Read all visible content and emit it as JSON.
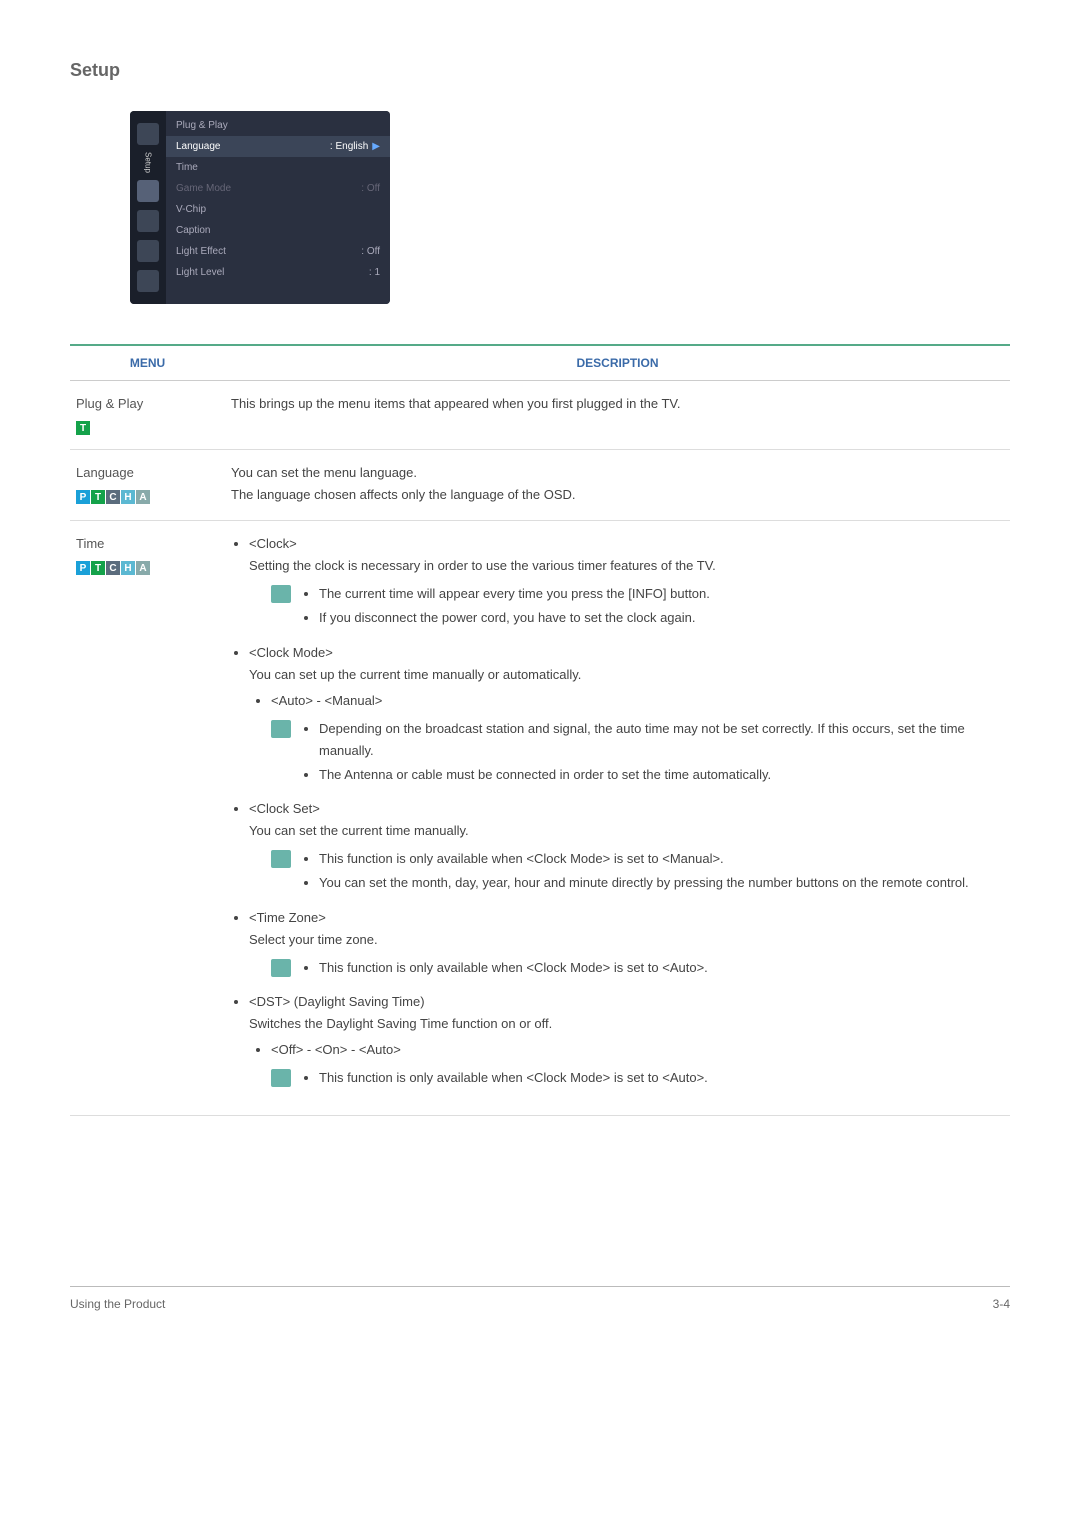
{
  "page_title": "Setup",
  "osd": {
    "sidetext": "Setup",
    "rows": [
      {
        "label": "Plug & Play",
        "value": ""
      },
      {
        "label": "Language",
        "value": "English",
        "selected": true,
        "arrow": true
      },
      {
        "label": "Time",
        "value": ""
      },
      {
        "label": "Game Mode",
        "value": "Off",
        "dim": true
      },
      {
        "label": "V-Chip",
        "value": ""
      },
      {
        "label": "Caption",
        "value": ""
      },
      {
        "label": "Light Effect",
        "value": "Off"
      },
      {
        "label": "Light Level",
        "value": "1"
      }
    ]
  },
  "table_headers": {
    "menu": "Menu",
    "desc": "Description"
  },
  "rows": {
    "plugplay": {
      "name": "Plug & Play",
      "badges": [
        "T"
      ],
      "desc": "This brings up the menu items that appeared when you first plugged in the TV."
    },
    "language": {
      "name": "Language",
      "badges": [
        "P",
        "T",
        "C",
        "H",
        "A"
      ],
      "desc1": "You can set the menu language.",
      "desc2": "The language chosen affects only the language of the OSD."
    },
    "time": {
      "name": "Time",
      "badges": [
        "P",
        "T",
        "C",
        "H",
        "A"
      ],
      "clock": {
        "title": "<Clock>",
        "sub": "Setting the clock is necessary in order to use the various timer features of the TV.",
        "note1": "The current time will appear every time you press the [INFO] button.",
        "note2": "If you disconnect the power cord, you have to set the clock again."
      },
      "clockmode": {
        "title": "<Clock Mode>",
        "sub": "You can set up the current time manually or automatically.",
        "opt": "<Auto> - <Manual>",
        "note1": "Depending on the broadcast station and signal, the auto time may not be set correctly. If this occurs, set the time manually.",
        "note2": "The Antenna or cable must be connected in order to set the time automatically."
      },
      "clockset": {
        "title": "<Clock Set>",
        "sub": "You can set the current time manually.",
        "note1": "This function is only available when <Clock Mode> is set to <Manual>.",
        "note2": "You can set the month, day, year, hour and minute directly by pressing the number buttons on the remote control."
      },
      "timezone": {
        "title": "<Time Zone>",
        "sub": "Select your time zone.",
        "note1": "This function is only available when <Clock Mode> is set to <Auto>."
      },
      "dst": {
        "title": "<DST> (Daylight Saving Time)",
        "sub": "Switches the Daylight Saving Time function on or off.",
        "opt": "<Off> - <On> - <Auto>",
        "note1": "This function is only available when <Clock Mode> is set to <Auto>."
      }
    }
  },
  "footer": {
    "left": "Using the Product",
    "right": "3-4"
  }
}
